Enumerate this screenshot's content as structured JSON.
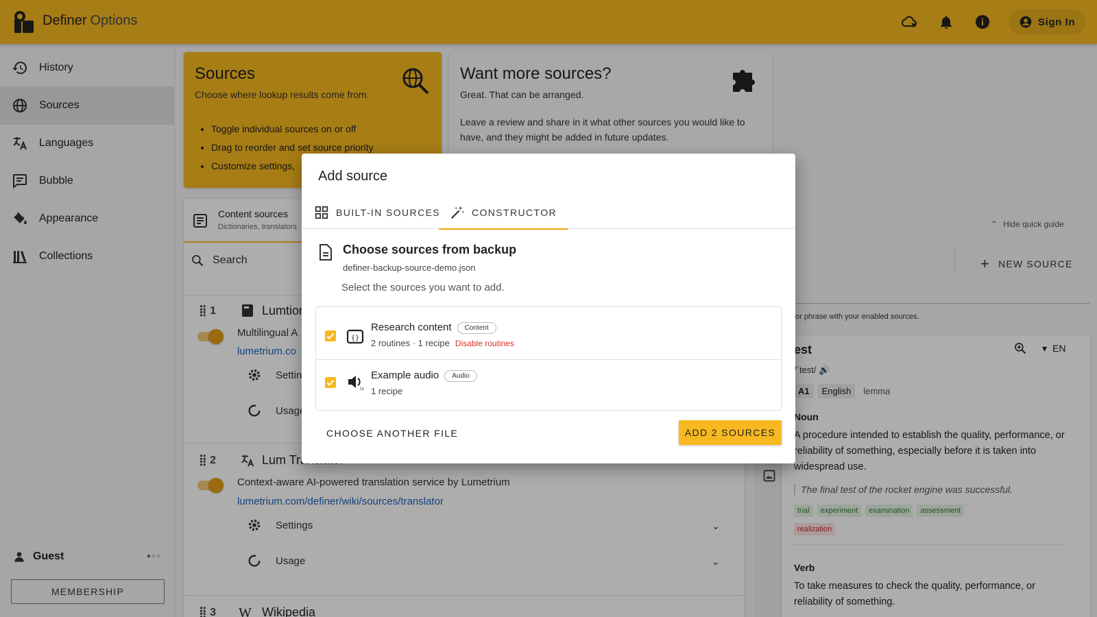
{
  "app": {
    "title": "Definer",
    "subtitle": "Options"
  },
  "header": {
    "sign_in_label": "Sign In"
  },
  "sidebar": {
    "items": [
      {
        "label": "History",
        "icon": "history-icon"
      },
      {
        "label": "Sources",
        "icon": "globe-icon",
        "active": true
      },
      {
        "label": "Languages",
        "icon": "translate-icon"
      },
      {
        "label": "Bubble",
        "icon": "bubble-icon"
      },
      {
        "label": "Appearance",
        "icon": "paint-icon"
      },
      {
        "label": "Collections",
        "icon": "library-icon"
      }
    ],
    "user": "Guest",
    "membership_label": "MEMBERSHIP"
  },
  "sources_card": {
    "title": "Sources",
    "subtitle": "Choose where lookup results come from.",
    "bullets": [
      "Toggle individual sources on or off",
      "Drag to reorder and set source priority",
      "Customize settings,"
    ]
  },
  "more_card": {
    "title": "Want more sources?",
    "subtitle": "Great. That can be arranged.",
    "body": "Leave a review and share in it what other sources you would like to have, and they might be added in future updates."
  },
  "panel": {
    "tab_label": "Content sources",
    "tab_sub": "Dictionaries, translators",
    "search_placeholder": "Search",
    "sources": [
      {
        "index": "1",
        "name": "Lumtion",
        "desc": "Multilingual A",
        "link": "lumetrium.co"
      },
      {
        "index": "2",
        "name": "Lum Translator",
        "desc": "Context-aware AI-powered translation service by Lumetrium",
        "link": "lumetrium.com/definer/wiki/sources/translator"
      },
      {
        "index": "3",
        "name": "Wikipedia"
      }
    ],
    "settings_label": "Settings",
    "usage_label": "Usage"
  },
  "right": {
    "quick_guide_label": "Hide quick guide",
    "new_source_label": "NEW SOURCE",
    "hint": "or phrase with your enabled sources.",
    "word": "est",
    "lang": "EN",
    "pron": "/ˈtest/",
    "tags": [
      "A1",
      "English",
      "lemma"
    ],
    "noun_label": "Noun",
    "noun_def": "A procedure intended to establish the quality, performance, or reliability of something, especially before it is taken into widespread use.",
    "example": "The final test of the rocket engine was successful.",
    "synonyms": [
      "trial",
      "experiment",
      "examination",
      "assessment"
    ],
    "antonym": "realization",
    "verb_label": "Verb",
    "verb_def": "To take measures to check the quality, performance, or reliability of something."
  },
  "modal": {
    "title": "Add source",
    "tabs": [
      "BUILT-IN SOURCES",
      "CONSTRUCTOR"
    ],
    "backup_title": "Choose sources from backup",
    "backup_file": "definer-backup-source-demo.json",
    "hint": "Select the sources you want to add.",
    "items": [
      {
        "name": "Research content",
        "chip": "Content",
        "meta": "2 routines · 1 recipe",
        "action": "Disable routines",
        "checked": true
      },
      {
        "name": "Example audio",
        "chip": "Audio",
        "meta": "1 recipe",
        "checked": true
      }
    ],
    "choose_label": "CHOOSE ANOTHER FILE",
    "add_label": "ADD 2 SOURCES"
  },
  "colors": {
    "accent": "#f7b820",
    "link": "#1e63b8",
    "danger": "#d93025"
  }
}
